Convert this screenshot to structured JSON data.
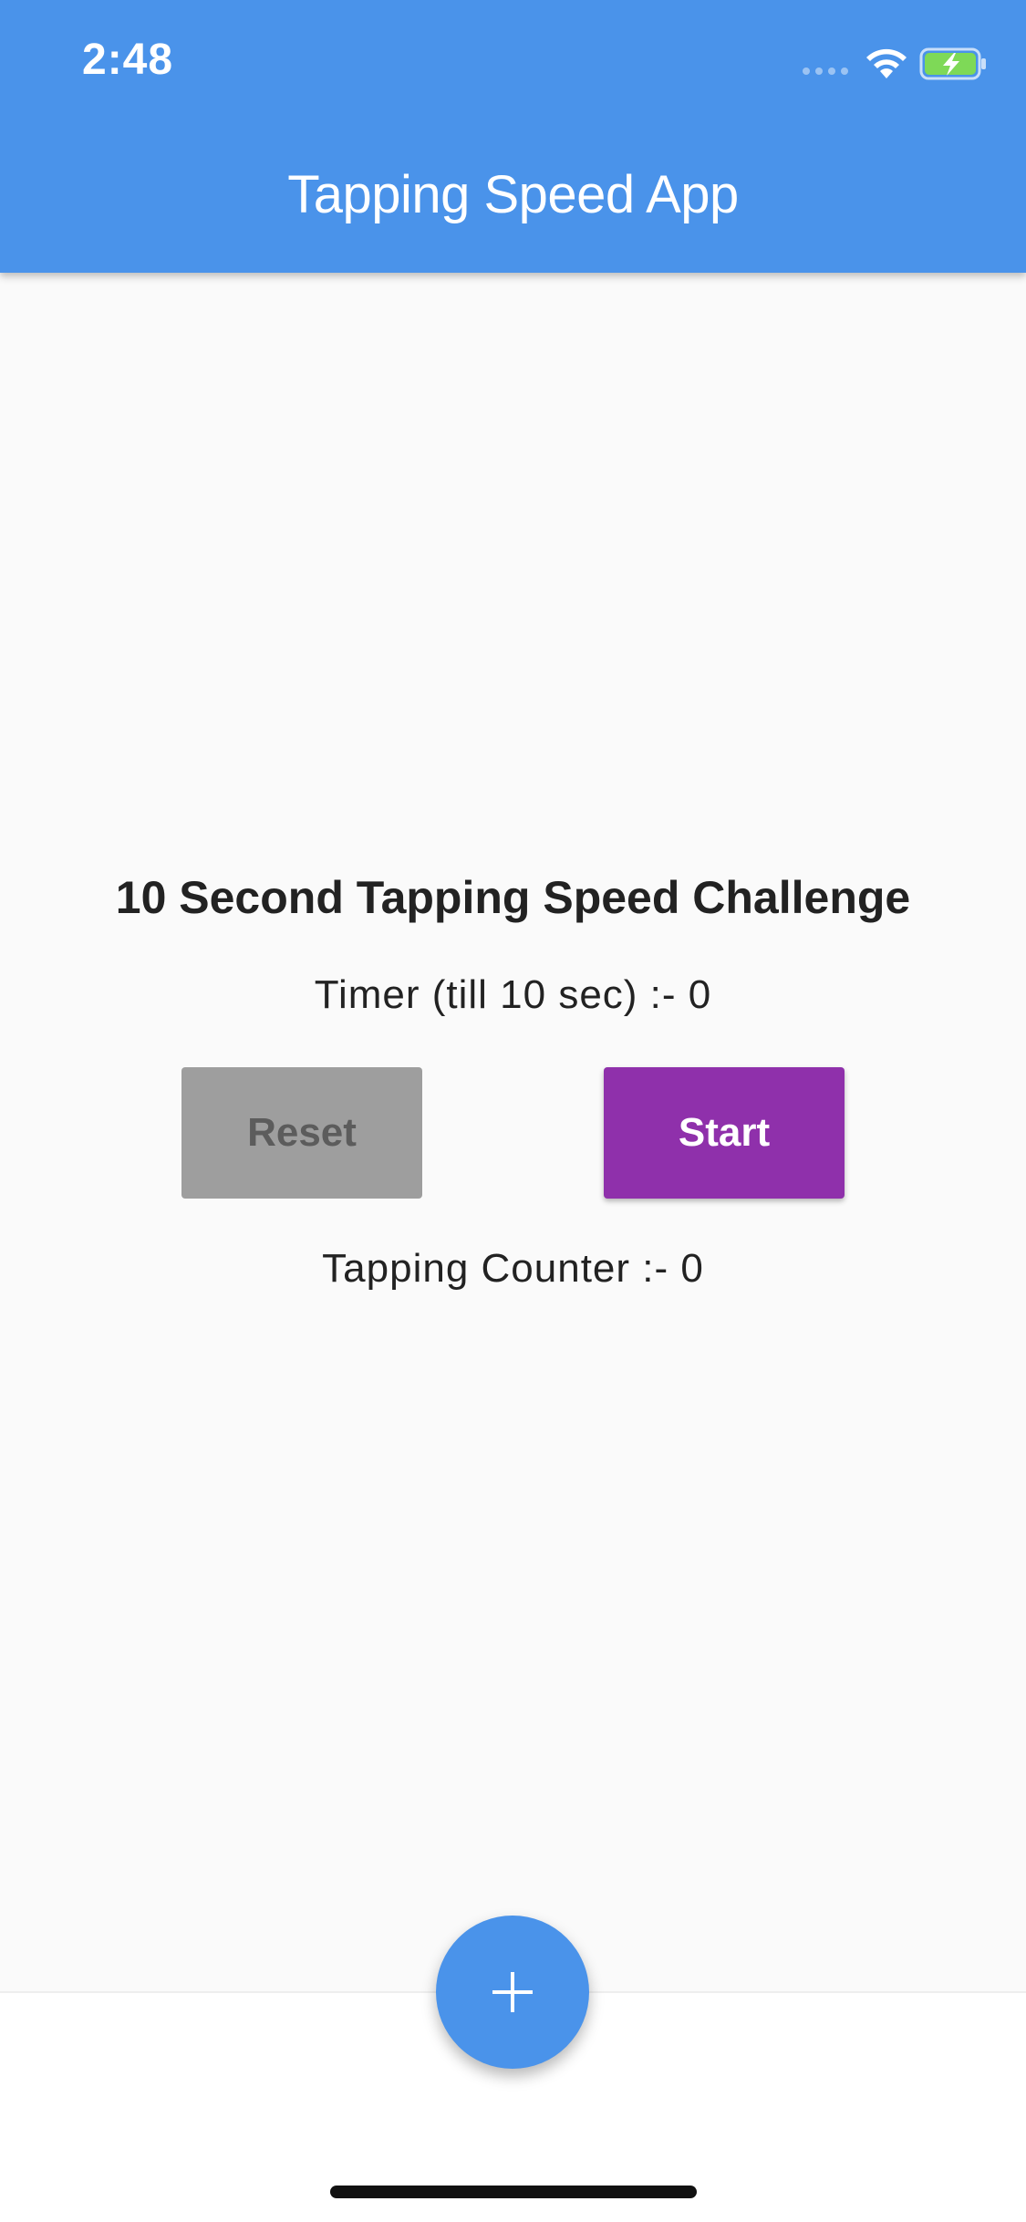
{
  "status_bar": {
    "time": "2:48",
    "icons": [
      "signal-dots-icon",
      "wifi-icon",
      "battery-charging-icon"
    ]
  },
  "app_bar": {
    "title": "Tapping Speed App"
  },
  "main": {
    "challenge_title": "10 Second Tapping Speed Challenge",
    "timer_text": "Timer (till 10 sec) :- 0",
    "reset_label": "Reset",
    "start_label": "Start",
    "counter_text": "Tapping Counter :- 0"
  },
  "fab": {
    "icon": "plus-icon"
  },
  "colors": {
    "primary": "#4a93ea",
    "start_button": "#8f30ab",
    "reset_button": "#9e9e9e",
    "background": "#fafafa",
    "battery_fill": "#7ed957"
  }
}
